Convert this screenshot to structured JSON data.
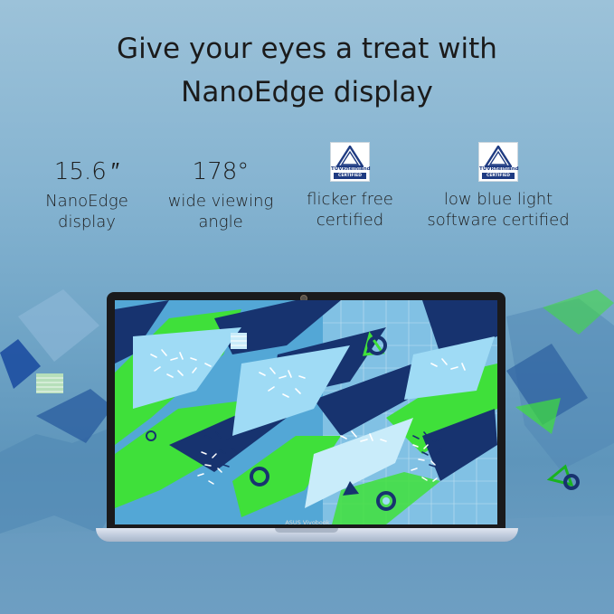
{
  "headline": {
    "line1": "Give your eyes a treat with",
    "line2": "NanoEdge display"
  },
  "features": [
    {
      "value": "15.6 ″",
      "desc_line1": "NanoEdge",
      "desc_line2": "display"
    },
    {
      "value": "178°",
      "desc_line1": "wide viewing",
      "desc_line2": "angle"
    },
    {
      "badge_brand": "TÜVRheinland",
      "badge_label": "CERTIFIED",
      "desc_line1": "flicker free",
      "desc_line2": "certified"
    },
    {
      "badge_brand": "TÜVRheinland",
      "badge_label": "CERTIFIED",
      "desc_line1": "low blue light",
      "desc_line2": "software certified"
    }
  ],
  "laptop": {
    "brand": "ASUS Vivobook"
  },
  "colors": {
    "background": "#86b4d1",
    "bezel": "#1a1a1c",
    "screen_blue": "#53a7d6",
    "lime": "#3fe03a",
    "navy": "#17336f",
    "tuv_blue": "#1f3b82"
  }
}
